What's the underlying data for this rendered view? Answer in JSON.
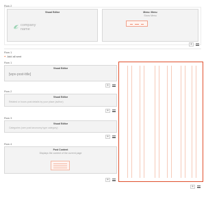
{
  "rows_top": {
    "label": "Row 2"
  },
  "header_modules": {
    "left": {
      "title": "Visual Editor",
      "logo_text_line1": "company",
      "logo_text_line2": "name"
    },
    "right": {
      "title": "Menu: Menu",
      "subtitle": "Show Menu"
    }
  },
  "section_label": "Row 1",
  "add_link": {
    "icon": "plus-icon",
    "label": "Add all sent"
  },
  "rows": [
    {
      "label": "Row 1",
      "module_title": "Visual Editor",
      "placeholder": "[wpv-post-title]"
    },
    {
      "label": "Row 2",
      "module_title": "Visual Editor",
      "placeholder": "Related or hours post details by your place (author)"
    },
    {
      "label": "Row 3",
      "module_title": "Visual Editor",
      "placeholder": "Categories (see post taxonomy type category)"
    },
    {
      "label": "Row 4",
      "module_title": "Post Content",
      "subtitle": "Displays the content of the current page"
    }
  ],
  "buttons": {
    "add": "+",
    "menu_icon": "hamburger-icon"
  },
  "colors": {
    "accent": "#e04e2b",
    "accent_light": "#f6c9b8",
    "module_bg": "#f3f3f3",
    "border": "#d8d8d8"
  }
}
